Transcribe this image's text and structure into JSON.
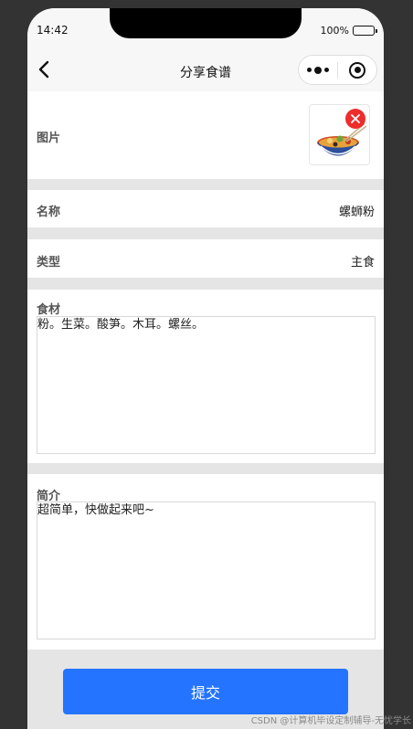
{
  "status": {
    "time": "14:42",
    "battery": "100%"
  },
  "nav": {
    "title": "分享食谱"
  },
  "form": {
    "image_label": "图片",
    "name_label": "名称",
    "name_value": "螺蛳粉",
    "type_label": "类型",
    "type_value": "主食",
    "ingredients_label": "食材",
    "ingredients_value": "粉。生菜。酸笋。木耳。螺丝。",
    "intro_label": "简介",
    "intro_value": "超简单，快做起来吧~"
  },
  "submit_label": "提交",
  "watermark": "CSDN @计算机毕设定制辅导-无忧学长",
  "colors": {
    "primary": "#2474ff",
    "delete": "#ee2c2c",
    "background": "#e5e5e5"
  }
}
